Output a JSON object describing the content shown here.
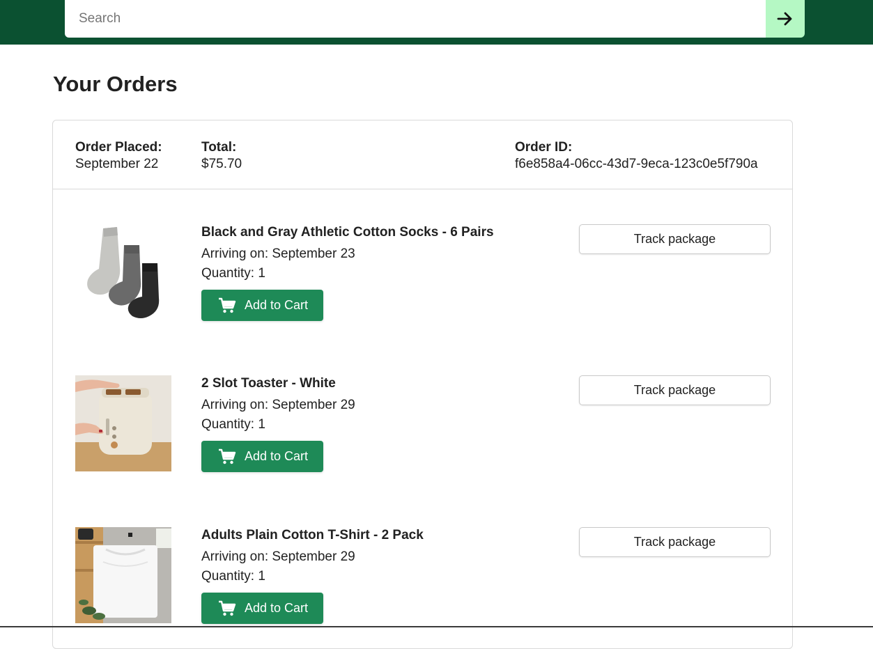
{
  "search": {
    "placeholder": "Search",
    "button_icon": "arrow-right-icon"
  },
  "page": {
    "title": "Your Orders"
  },
  "order": {
    "placed_label": "Order Placed:",
    "placed_value": "September 22",
    "total_label": "Total:",
    "total_value": "$75.70",
    "id_label": "Order ID:",
    "id_value": "f6e858a4-06cc-43d7-9eca-123c0e5f790a"
  },
  "items": [
    {
      "name": "Black and Gray Athletic Cotton Socks - 6 Pairs",
      "arriving": "Arriving on: September 23",
      "quantity": "Quantity: 1",
      "add_to_cart_label": "Add to Cart",
      "track_label": "Track package",
      "image_icon": "socks-image"
    },
    {
      "name": "2 Slot Toaster - White",
      "arriving": "Arriving on: September 29",
      "quantity": "Quantity: 1",
      "add_to_cart_label": "Add to Cart",
      "track_label": "Track package",
      "image_icon": "toaster-image"
    },
    {
      "name": "Adults Plain Cotton T-Shirt - 2 Pack",
      "arriving": "Arriving on: September 29",
      "quantity": "Quantity: 1",
      "add_to_cart_label": "Add to Cart",
      "track_label": "Track package",
      "image_icon": "tshirt-image"
    }
  ],
  "colors": {
    "header_bg": "#0b5131",
    "search_button_bg": "#b5f8c4",
    "add_to_cart_bg": "#1e8a57"
  }
}
